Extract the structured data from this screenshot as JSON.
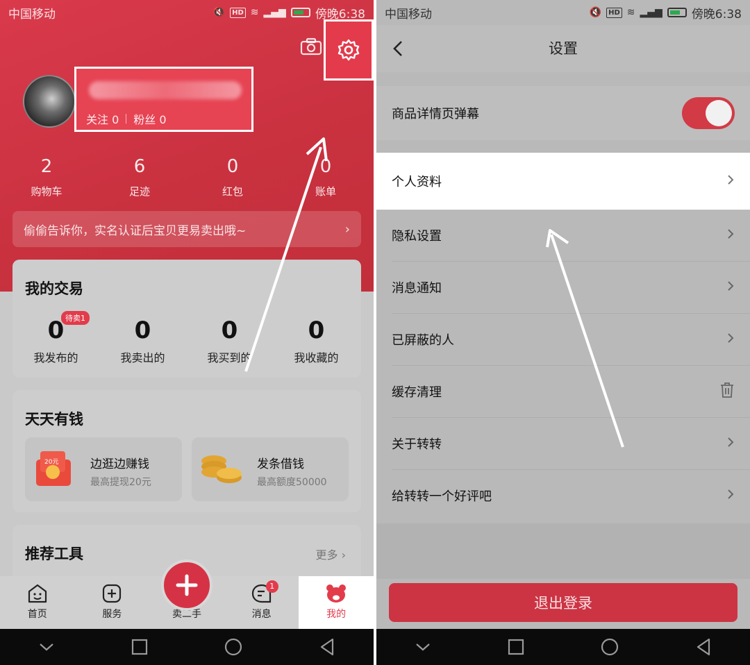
{
  "left": {
    "status_bar": {
      "carrier": "中国移动",
      "time": "傍晚6:38"
    },
    "profile": {
      "follow_label": "关注 0",
      "fans_label": "粉丝 0"
    },
    "stats": [
      {
        "value": "2",
        "label": "购物车"
      },
      {
        "value": "6",
        "label": "足迹"
      },
      {
        "value": "0",
        "label": "红包"
      },
      {
        "value": "0",
        "label": "账单"
      }
    ],
    "notice": {
      "text": "偷偷告诉你，实名认证后宝贝更易卖出哦~"
    },
    "trade": {
      "title": "我的交易",
      "items": [
        {
          "value": "0",
          "label": "我发布的",
          "badge": "待卖1"
        },
        {
          "value": "0",
          "label": "我卖出的"
        },
        {
          "value": "0",
          "label": "我买到的"
        },
        {
          "value": "0",
          "label": "我收藏的"
        }
      ]
    },
    "money": {
      "title": "天天有钱",
      "items": [
        {
          "title": "边逛边赚钱",
          "subtitle": "最高提现20元",
          "icon_text": "20元"
        },
        {
          "title": "发条借钱",
          "subtitle": "最高额度50000"
        }
      ]
    },
    "tools": {
      "title": "推荐工具",
      "more_label": "更多"
    },
    "tabbar": [
      {
        "label": "首页",
        "icon": "home-face-icon"
      },
      {
        "label": "服务",
        "icon": "service-plus-icon"
      },
      {
        "label": "卖二手",
        "icon": "publish-plus-icon"
      },
      {
        "label": "消息",
        "icon": "message-icon",
        "badge": "1"
      },
      {
        "label": "我的",
        "icon": "bear-face-icon"
      }
    ]
  },
  "right": {
    "status_bar": {
      "carrier": "中国移动",
      "time": "傍晚6:38"
    },
    "header": {
      "title": "设置"
    },
    "danmu_row": {
      "label": "商品详情页弹幕",
      "enabled": true
    },
    "rows": [
      {
        "label": "个人资料"
      },
      {
        "label": "隐私设置"
      },
      {
        "label": "消息通知"
      },
      {
        "label": "已屏蔽的人"
      },
      {
        "label": "缓存清理",
        "icon": "trash-icon"
      },
      {
        "label": "关于转转"
      },
      {
        "label": "给转转一个好评吧"
      }
    ],
    "logout_label": "退出登录"
  },
  "colors": {
    "brand_red": "#d53345",
    "highlight_white": "#ffffff"
  }
}
